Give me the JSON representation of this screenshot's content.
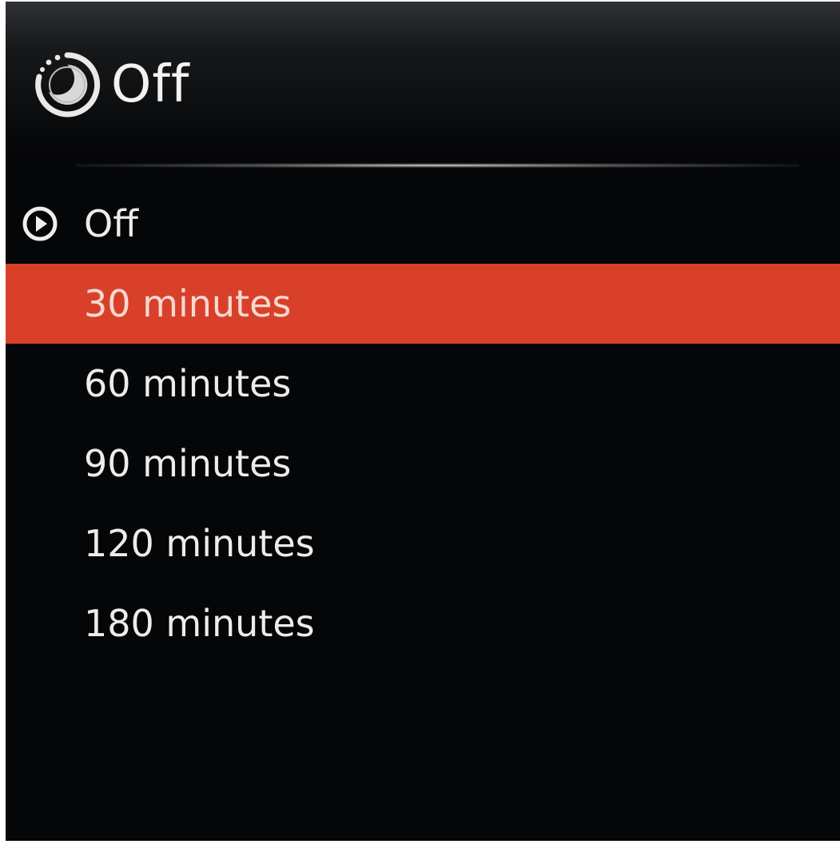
{
  "header": {
    "icon": "sleep-timer-icon",
    "title": "Off"
  },
  "menu": {
    "selected_index": 0,
    "highlighted_index": 1,
    "items": [
      {
        "label": "Off"
      },
      {
        "label": "30 minutes"
      },
      {
        "label": "60 minutes"
      },
      {
        "label": "90 minutes"
      },
      {
        "label": "120 minutes"
      },
      {
        "label": "180 minutes"
      }
    ]
  },
  "colors": {
    "background": "#050608",
    "highlight": "#d9402a",
    "text": "#ececec"
  }
}
